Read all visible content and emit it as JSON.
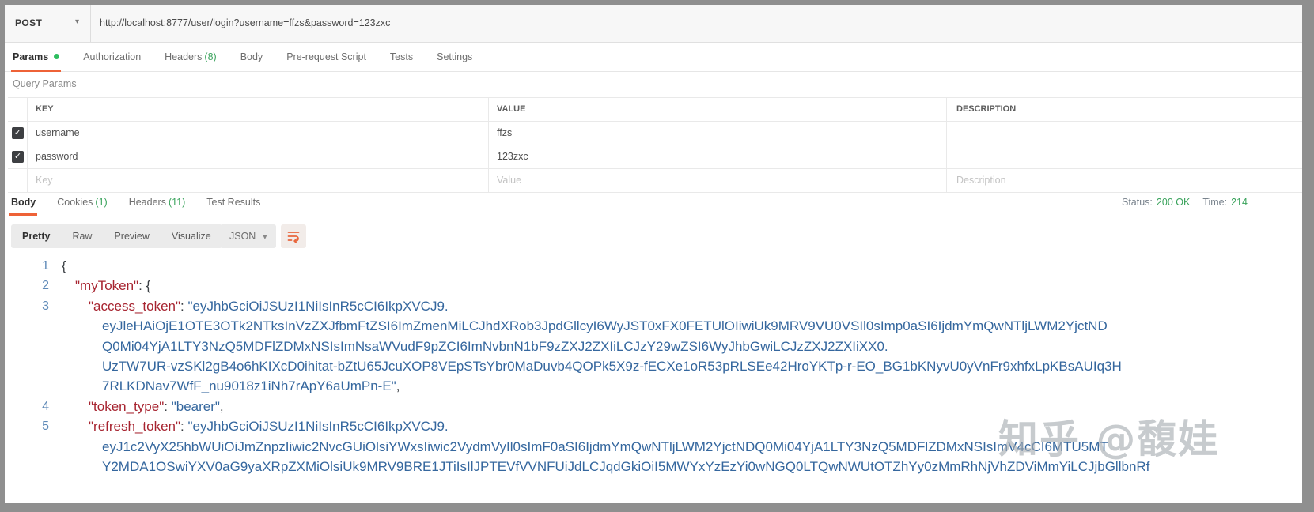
{
  "request": {
    "method": "POST",
    "url": "http://localhost:8777/user/login?username=ffzs&password=123zxc",
    "tabs": [
      {
        "label": "Params",
        "active": true,
        "dot": true
      },
      {
        "label": "Authorization"
      },
      {
        "label": "Headers",
        "count": "(8)"
      },
      {
        "label": "Body"
      },
      {
        "label": "Pre-request Script"
      },
      {
        "label": "Tests"
      },
      {
        "label": "Settings"
      }
    ]
  },
  "query_params": {
    "section_label": "Query Params",
    "columns": [
      "KEY",
      "VALUE",
      "DESCRIPTION"
    ],
    "rows": [
      {
        "key": "username",
        "value": "ffzs",
        "description": "",
        "checked": true
      },
      {
        "key": "password",
        "value": "123zxc",
        "description": "",
        "checked": true
      }
    ],
    "placeholder_row": {
      "key": "Key",
      "value": "Value",
      "description": "Description"
    }
  },
  "response": {
    "tabs": [
      {
        "label": "Body",
        "active": true
      },
      {
        "label": "Cookies",
        "count": "(1)"
      },
      {
        "label": "Headers",
        "count": "(11)"
      },
      {
        "label": "Test Results"
      }
    ],
    "status_label": "Status:",
    "status_value": "200 OK",
    "time_label": "Time:",
    "time_value": "214",
    "views": [
      {
        "label": "Pretty",
        "active": true
      },
      {
        "label": "Raw"
      },
      {
        "label": "Preview"
      },
      {
        "label": "Visualize"
      }
    ],
    "format_selected": "JSON"
  },
  "response_body": {
    "lines": [
      {
        "num": 1,
        "indent": 0,
        "segs": [
          {
            "t": "{",
            "c": "p"
          }
        ]
      },
      {
        "num": 2,
        "indent": 1,
        "segs": [
          {
            "t": "\"myToken\"",
            "c": "k"
          },
          {
            "t": ": ",
            "c": "p"
          },
          {
            "t": "{",
            "c": "p"
          }
        ]
      },
      {
        "num": 3,
        "indent": 2,
        "segs": [
          {
            "t": "\"access_token\"",
            "c": "k"
          },
          {
            "t": ": ",
            "c": "p"
          },
          {
            "t": "\"eyJhbGciOiJSUzI1NiIsInR5cCI6IkpXVCJ9.",
            "c": "v"
          }
        ]
      },
      {
        "num": null,
        "indent": 3,
        "segs": [
          {
            "t": "eyJleHAiOjE1OTE3OTk2NTksInVzZXJfbmFtZSI6ImZmenMiLCJhdXRob3JpdGllcyI6WyJST0xFX0FETUlOIiwiUk9MRV9VU0VSIl0sImp0aSI6IjdmYmQwNTljLWM2YjctND",
            "c": "v"
          }
        ]
      },
      {
        "num": null,
        "indent": 3,
        "segs": [
          {
            "t": "Q0Mi04YjA1LTY3NzQ5MDFlZDMxNSIsImNsaWVudF9pZCI6ImNvbnN1bF9zZXJ2ZXIiLCJzY29wZSI6WyJhbGwiLCJzZXJ2ZXIiXX0.",
            "c": "v"
          }
        ]
      },
      {
        "num": null,
        "indent": 3,
        "segs": [
          {
            "t": "UzTW7UR-vzSKl2gB4o6hKIXcD0ihitat-bZtU65JcuXOP8VEpSTsYbr0MaDuvb4QOPk5X9z-fECXe1oR53pRLSEe42HroYKTp-r-EO_BG1bKNyvU0yVnFr9xhfxLpKBsAUIq3H",
            "c": "v"
          }
        ]
      },
      {
        "num": null,
        "indent": 3,
        "segs": [
          {
            "t": "7RLKDNav7WfF_nu9018z1iNh7rApY6aUmPn-E\"",
            "c": "v"
          },
          {
            "t": ",",
            "c": "p"
          }
        ]
      },
      {
        "num": 4,
        "indent": 2,
        "segs": [
          {
            "t": "\"token_type\"",
            "c": "k"
          },
          {
            "t": ": ",
            "c": "p"
          },
          {
            "t": "\"bearer\"",
            "c": "v"
          },
          {
            "t": ",",
            "c": "p"
          }
        ]
      },
      {
        "num": 5,
        "indent": 2,
        "segs": [
          {
            "t": "\"refresh_token\"",
            "c": "k"
          },
          {
            "t": ": ",
            "c": "p"
          },
          {
            "t": "\"eyJhbGciOiJSUzI1NiIsInR5cCI6IkpXVCJ9.",
            "c": "v"
          }
        ]
      },
      {
        "num": null,
        "indent": 3,
        "segs": [
          {
            "t": "eyJ1c2VyX25hbWUiOiJmZnpzIiwic2NvcGUiOlsiYWxsIiwic2VydmVyIl0sImF0aSI6IjdmYmQwNTljLWM2YjctNDQ0Mi04YjA1LTY3NzQ5MDFlZDMxNSIsImV4cCI6MTU5MT",
            "c": "v"
          }
        ]
      },
      {
        "num": null,
        "indent": 3,
        "segs": [
          {
            "t": "Y2MDA1OSwiYXV0aG9yaXRpZXMiOlsiUk9MRV9BRE1JTiIsIlJPTEVfVVNFUiJdLCJqdGkiOiI5MWYxYzEzYi0wNGQ0LTQwNWUtOTZhYy0zMmRhNjVhZDViMmYiLCJjbGllbnRf",
            "c": "v"
          }
        ]
      }
    ]
  },
  "watermark": "知乎 @馥娃",
  "colors": {
    "accent_orange": "#ee6237",
    "success_green": "#3aa35c",
    "unsaved_dot_green": "#2ebd5f",
    "key_red": "#a72430",
    "value_blue": "#35679e",
    "line_number_blue": "#5f8ab8",
    "toolbar_gray": "#ebebeb",
    "url_bar_gray": "#f7f7f7"
  }
}
